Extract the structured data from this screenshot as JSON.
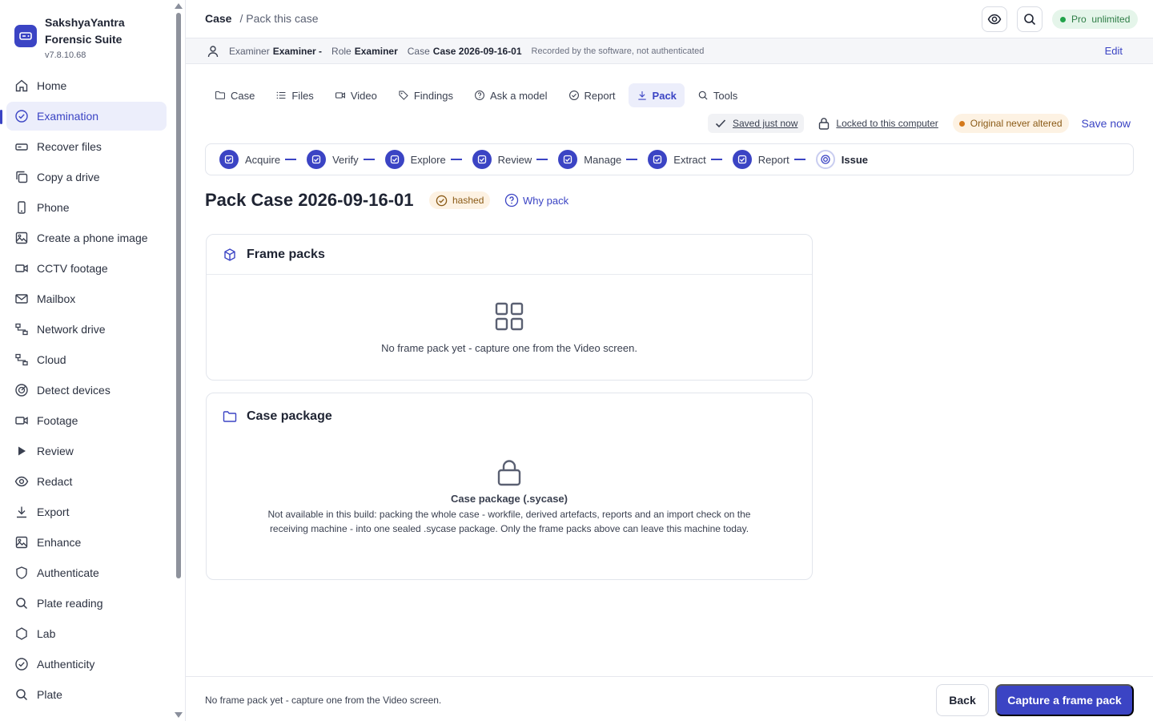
{
  "app": {
    "name_line1": "SakshyaYantra",
    "name_line2": "Forensic Suite",
    "version": "v7.8.10.68"
  },
  "sidebar": {
    "items": [
      {
        "label": "Home",
        "icon": "home-icon"
      },
      {
        "label": "Examination",
        "icon": "check-circle-icon",
        "active": true
      },
      {
        "label": "Recover files",
        "icon": "drive-icon"
      },
      {
        "label": "Copy a drive",
        "icon": "copy-icon"
      },
      {
        "label": "Phone",
        "icon": "phone-icon"
      },
      {
        "label": "Create a phone image",
        "icon": "image-icon"
      },
      {
        "label": "CCTV footage",
        "icon": "video-icon"
      },
      {
        "label": "Mailbox",
        "icon": "mail-icon"
      },
      {
        "label": "Network drive",
        "icon": "network-icon"
      },
      {
        "label": "Cloud",
        "icon": "network-icon"
      },
      {
        "label": "Detect devices",
        "icon": "radar-icon"
      },
      {
        "label": "Footage",
        "icon": "video-icon"
      },
      {
        "label": "Review",
        "icon": "play-icon"
      },
      {
        "label": "Redact",
        "icon": "eye-icon"
      },
      {
        "label": "Export",
        "icon": "download-icon"
      },
      {
        "label": "Enhance",
        "icon": "image-icon"
      },
      {
        "label": "Authenticate",
        "icon": "shield-icon"
      },
      {
        "label": "Plate reading",
        "icon": "search-icon"
      },
      {
        "label": "Lab",
        "icon": "hexagon-icon"
      },
      {
        "label": "Authenticity",
        "icon": "check-circle-icon"
      },
      {
        "label": "Plate",
        "icon": "search-icon"
      }
    ]
  },
  "header": {
    "crumb_root": "Case",
    "crumb_current": "/ Pack this case",
    "pro_label": "Pro  unlimited"
  },
  "infobar": {
    "examiner_label": "Examiner",
    "examiner_value": "Examiner -",
    "role_label": "Role",
    "role_value": "Examiner",
    "case_label": "Case",
    "case_value": "Case 2026-09-16-01",
    "note": "Recorded by the software, not authenticated",
    "edit": "Edit"
  },
  "tabs": [
    {
      "label": "Case",
      "icon": "folder-icon"
    },
    {
      "label": "Files",
      "icon": "list-icon"
    },
    {
      "label": "Video",
      "icon": "video-icon"
    },
    {
      "label": "Findings",
      "icon": "tag-icon"
    },
    {
      "label": "Ask a model",
      "icon": "help-icon"
    },
    {
      "label": "Report",
      "icon": "check-circle-icon"
    },
    {
      "label": "Pack",
      "icon": "download-icon",
      "active": true
    },
    {
      "label": "Tools",
      "icon": "search-icon"
    }
  ],
  "status": {
    "saved": "Saved just now",
    "locked": "Locked to this computer",
    "original": "Original never altered",
    "save_now": "Save now"
  },
  "steps": [
    "Acquire",
    "Verify",
    "Explore",
    "Review",
    "Manage",
    "Extract",
    "Report",
    "Issue"
  ],
  "page": {
    "title": "Pack Case 2026-09-16-01",
    "badge": "hashed",
    "why": "Why pack"
  },
  "frame_packs": {
    "title": "Frame packs",
    "empty": "No frame pack yet - capture one from the Video screen."
  },
  "case_package": {
    "title": "Case package",
    "item_title": "Case package (.sycase)",
    "desc_line1": "Not available in this build: packing the whole case - workfile, derived artefacts, reports and an import check on the",
    "desc_line2": "receiving machine - into one sealed .sycase package. Only the frame packs above can leave this machine today."
  },
  "footer": {
    "message": "No frame pack yet - capture one from the Video screen.",
    "back": "Back",
    "capture": "Capture a frame pack"
  },
  "colors": {
    "accent": "#3b44c4",
    "success": "#22a34a",
    "warning": "#d4791b"
  }
}
